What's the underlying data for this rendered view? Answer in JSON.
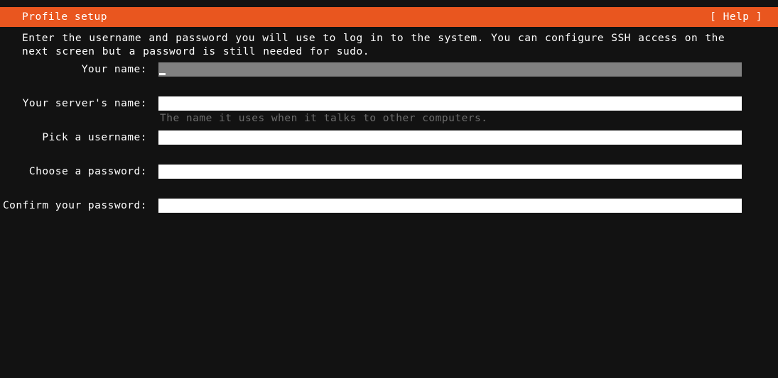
{
  "window": {
    "title": "Profile setup",
    "help_label": "[ Help ]",
    "accent_color": "#e9561f",
    "background_color": "#121212",
    "text_color": "#ffffff",
    "field_color": "#ffffff",
    "focused_field_color": "#808080",
    "help_text_color": "#6e6e6e"
  },
  "instructions": "Enter the username and password you will use to log in to the system. You can configure SSH access on the next screen but a password is still needed for sudo.",
  "form": {
    "fields": [
      {
        "label": "Your name:",
        "value": "",
        "focused": true,
        "help": ""
      },
      {
        "label": "Your server's name:",
        "value": "",
        "focused": false,
        "help": "The name it uses when it talks to other computers."
      },
      {
        "label": "Pick a username:",
        "value": "",
        "focused": false,
        "help": ""
      },
      {
        "label": "Choose a password:",
        "value": "",
        "focused": false,
        "help": ""
      },
      {
        "label": "Confirm your password:",
        "value": "",
        "focused": false,
        "help": ""
      }
    ]
  }
}
